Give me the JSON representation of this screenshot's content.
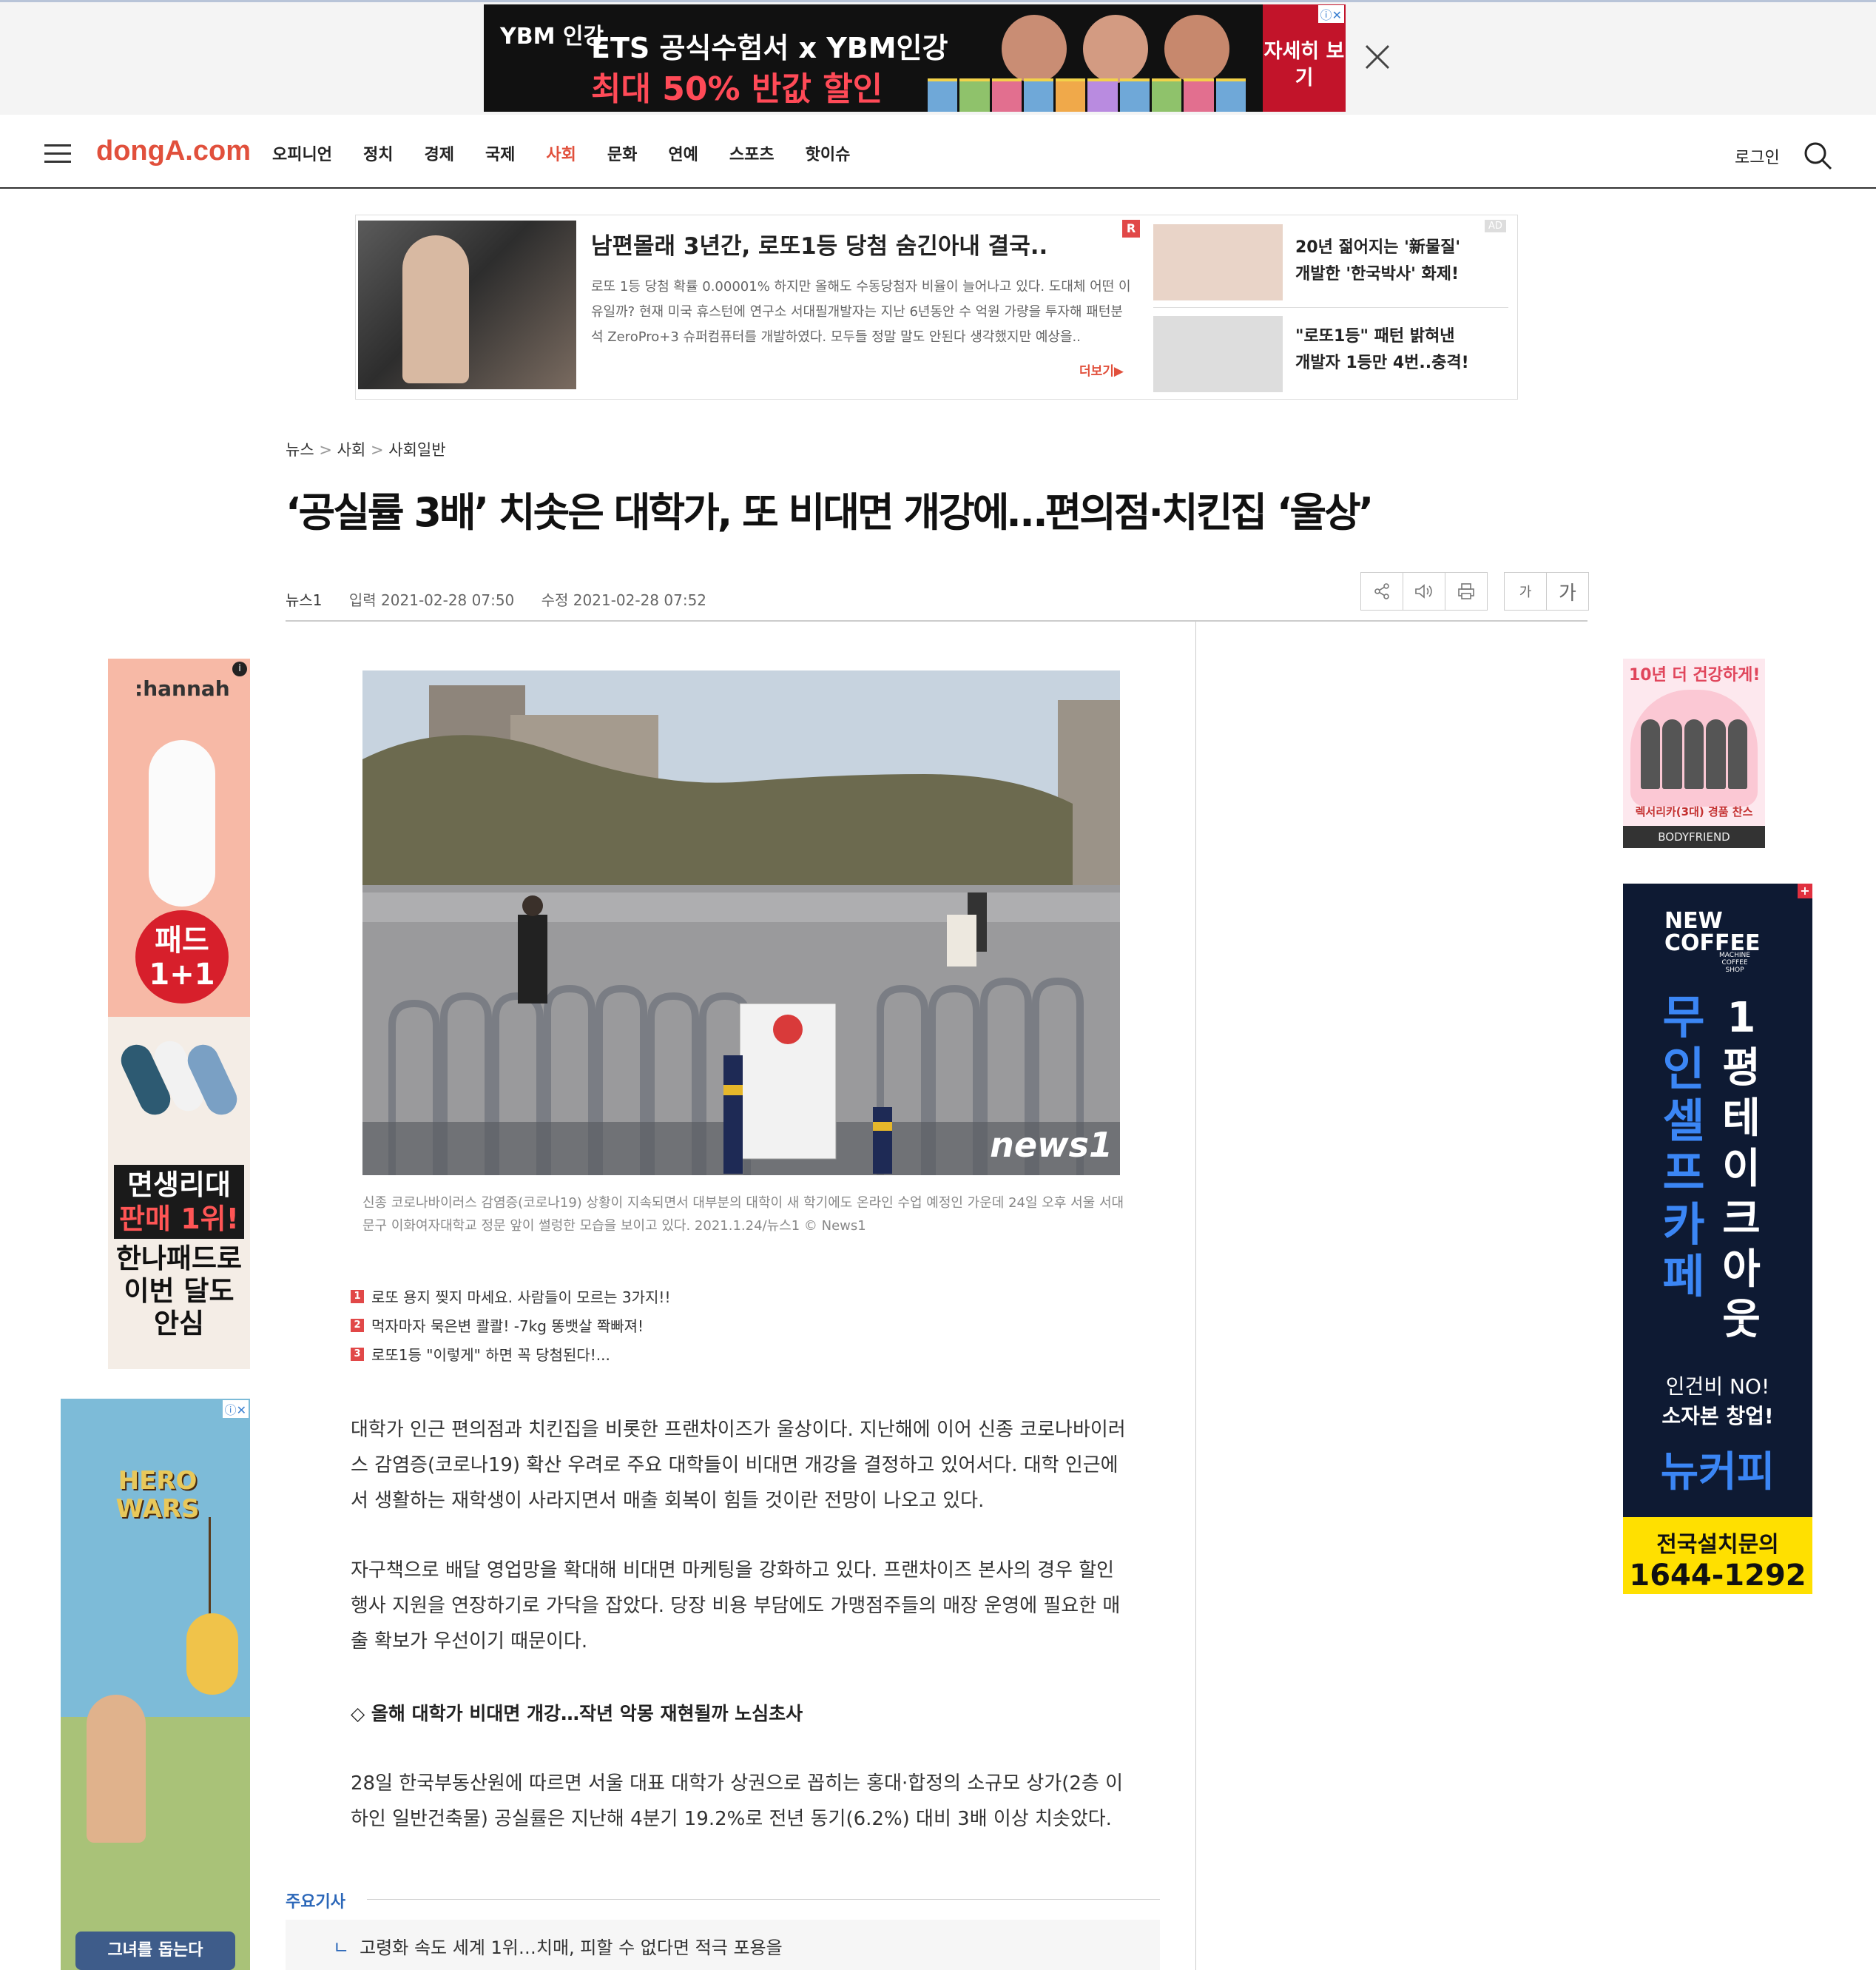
{
  "top_ad": {
    "brand": "YBM 인강",
    "line1": "ETS 공식수험서 x YBM인강",
    "line2": "최대 50% 반값 할인",
    "cta": "자세히 보기",
    "adchoices": "ⓘ✕"
  },
  "nav": {
    "logo": "dongA.com",
    "menu": [
      "오피니언",
      "정치",
      "경제",
      "국제",
      "사회",
      "문화",
      "연예",
      "스포츠",
      "핫이슈"
    ],
    "active": "사회",
    "login": "로그인"
  },
  "native_ad": {
    "title": "남편몰래 3년간, 로또1등 당첨 숨긴아내 결국..",
    "desc": "로또 1등 당첨 확률 0.00001% 하지만 올해도 수동당첨자 비율이 늘어나고 있다. 도대체 어떤 이유일까? 현재 미국 휴스턴에 연구소 서대필개발자는 지난 6년동안 수 억원 가량을 투자해 패턴분석 ZeroPro+3 슈퍼컴퓨터를 개발하였다. 모두들 정말 말도 안된다 생각했지만 예상을..",
    "more": "더보기▶",
    "r_badge": "R",
    "ad_label": "AD",
    "side1": [
      "20년 젊어지는 '新물질'",
      "개발한 '한국박사' 화제!"
    ],
    "side2": [
      "\"로또1등\" 패턴 밝혀낸",
      "개발자 1등만 4번..충격!"
    ]
  },
  "article": {
    "breadcrumb": [
      "뉴스",
      "사회",
      "사회일반"
    ],
    "headline": "‘공실률 3배’ 치솟은 대학가, 또 비대면 개강에…편의점·치킨집 ‘울상’",
    "source": "뉴스1",
    "input_time": "입력 2021-02-28 07:50",
    "edit_time": "수정 2021-02-28 07:52",
    "font_small": "가",
    "font_large": "가",
    "photo_watermark": "news1",
    "caption": "신종 코로나바이러스 감염증(코로나19) 상황이 지속되면서 대부분의 대학이 새 학기에도 온라인 수업 예정인 가운데 24일 오후 서울 서대문구 이화여자대학교 정문 앞이 썰렁한 모습을 보이고 있다. 2021.1.24/뉴스1 © News1",
    "promos": [
      {
        "n": "1",
        "text": "로또 용지 찢지 마세요. 사람들이 모르는 3가지!!"
      },
      {
        "n": "2",
        "text": "먹자마자 묵은변 콸콸! -7kg 똥뱃살 쫙빠져!"
      },
      {
        "n": "3",
        "text": "로또1등 \"이렇게\" 하면 꼭 당첨된다!..."
      }
    ],
    "para1": "대학가 인근 편의점과 치킨집을 비롯한 프랜차이즈가 울상이다. 지난해에 이어 신종 코로나바이러스 감염증(코로나19) 확산 우려로 주요 대학들이 비대면 개강을 결정하고 있어서다. 대학 인근에서 생활하는 재학생이 사라지면서 매출 회복이 힘들 것이란 전망이 나오고 있다.",
    "para2": "자구책으로 배달 영업망을 확대해 비대면 마케팅을 강화하고 있다. 프랜차이즈 본사의 경우 할인 행사 지원을 연장하기로 가닥을 잡았다. 당장 비용 부담에도 가맹점주들의 매장 운영에 필요한 매출 확보가 우선이기 때문이다.",
    "subhead": "◇ 올해 대학가 비대면 개강…작년 악몽 재현될까 노심초사",
    "para3": "28일 한국부동산원에 따르면 서울 대표 대학가 상권으로 꼽히는 홍대·합정의 소규모 상가(2층 이하인 일반건축물) 공실률은 지난해 4분기 19.2%로 전년 동기(6.2%) 대비 3배 이상 치솟았다.",
    "related_header": "주요기사",
    "related_item": "고령화 속도 세계 1위…치매, 피할 수 없다면 적극 포용을"
  },
  "left_ads": {
    "hannah": {
      "logo": ":hannah",
      "circle": "패드 1+1",
      "red1": "면생리대",
      "red2": "판매 1위!",
      "black": "한나패드로 이번 달도 안심"
    },
    "hero": {
      "logo": "HERO WARS",
      "bottom": "그녀를 돕는다"
    }
  },
  "right_ads": {
    "bodyfriend": {
      "top": "10년 더 건강하게!",
      "sub": "렉서리카(3대) 경품 찬스",
      "brand": "BODYFRIEND"
    },
    "newcoffee": {
      "logo1": "NEW",
      "logo2": "COFFEE",
      "small": "MACHINE COFFEE SHOP",
      "col1": [
        "무",
        "인",
        "셀",
        "프",
        "카",
        "페"
      ],
      "col2": [
        "1",
        "평",
        "테",
        "이",
        "크",
        "아",
        "웃"
      ],
      "mid1": "인건비 NO!",
      "mid2": "소자본 창업!",
      "brand": "뉴커피",
      "yellow1": "전국설치문의",
      "yellow2": "1644-1292"
    }
  }
}
